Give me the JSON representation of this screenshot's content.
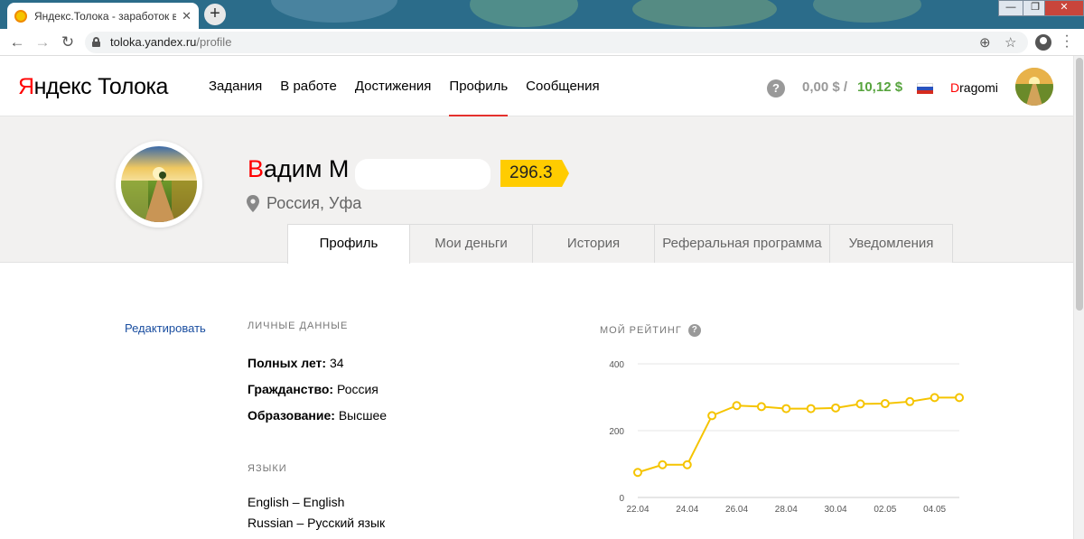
{
  "browser": {
    "tab_title": "Яндекс.Толока - заработок в ин",
    "tab_close": "✕",
    "new_tab": "+",
    "url_host": "toloka.yandex.ru",
    "url_path": "/profile",
    "window_controls": [
      "—",
      "❐",
      "✕"
    ]
  },
  "header": {
    "logo_ya": "Я",
    "logo_rest": "ндекс",
    "logo_product": "Толока",
    "nav": [
      {
        "label": "Задания"
      },
      {
        "label": "В работе"
      },
      {
        "label": "Достижения"
      },
      {
        "label": "Профиль",
        "active": true
      },
      {
        "label": "Сообщения"
      }
    ],
    "help": "?",
    "balance_pending": "0,00 $ /",
    "balance_available": "10,12 $",
    "username_first": "D",
    "username_rest": "ragomi"
  },
  "profile": {
    "name_first": "В",
    "name_rest": "адим М",
    "rating": "296.3",
    "location": "Россия, Уфа",
    "tabs": [
      {
        "label": "Профиль",
        "active": true
      },
      {
        "label": "Мои деньги"
      },
      {
        "label": "История"
      },
      {
        "label": "Реферальная программа"
      },
      {
        "label": "Уведомления"
      }
    ]
  },
  "content": {
    "edit_link": "Редактировать",
    "personal_heading": "ЛИЧНЫЕ ДАННЫЕ",
    "fields": [
      {
        "label": "Полных лет:",
        "value": " 34"
      },
      {
        "label": "Гражданство:",
        "value": " Россия"
      },
      {
        "label": "Образование:",
        "value": " Высшее"
      }
    ],
    "languages_heading": "ЯЗЫКИ",
    "languages": [
      "English – English",
      "Russian – Русский язык"
    ],
    "rating_heading": "МОЙ РЕЙТИНГ",
    "rating_help": "?"
  },
  "colors": {
    "accent_red": "#e5312d",
    "balance_green": "#57a43e",
    "rating_yellow": "#ffcc00",
    "link_blue": "#1a4ea0",
    "chart_line": "#f5c400"
  },
  "chart_data": {
    "type": "line",
    "title": "МОЙ РЕЙТИНГ",
    "xlabel": "",
    "ylabel": "",
    "ylim": [
      0,
      400
    ],
    "yticks": [
      0,
      200,
      400
    ],
    "xticks": [
      "22.04",
      "24.04",
      "26.04",
      "28.04",
      "30.04",
      "02.05",
      "04.05"
    ],
    "x": [
      "22.04",
      "23.04",
      "24.04",
      "25.04",
      "26.04",
      "27.04",
      "28.04",
      "29.04",
      "30.04",
      "01.05",
      "02.05",
      "03.05",
      "04.05",
      "05.05"
    ],
    "values": [
      75,
      98,
      98,
      245,
      275,
      272,
      266,
      266,
      268,
      280,
      281,
      287,
      299,
      299
    ],
    "grid": true
  }
}
